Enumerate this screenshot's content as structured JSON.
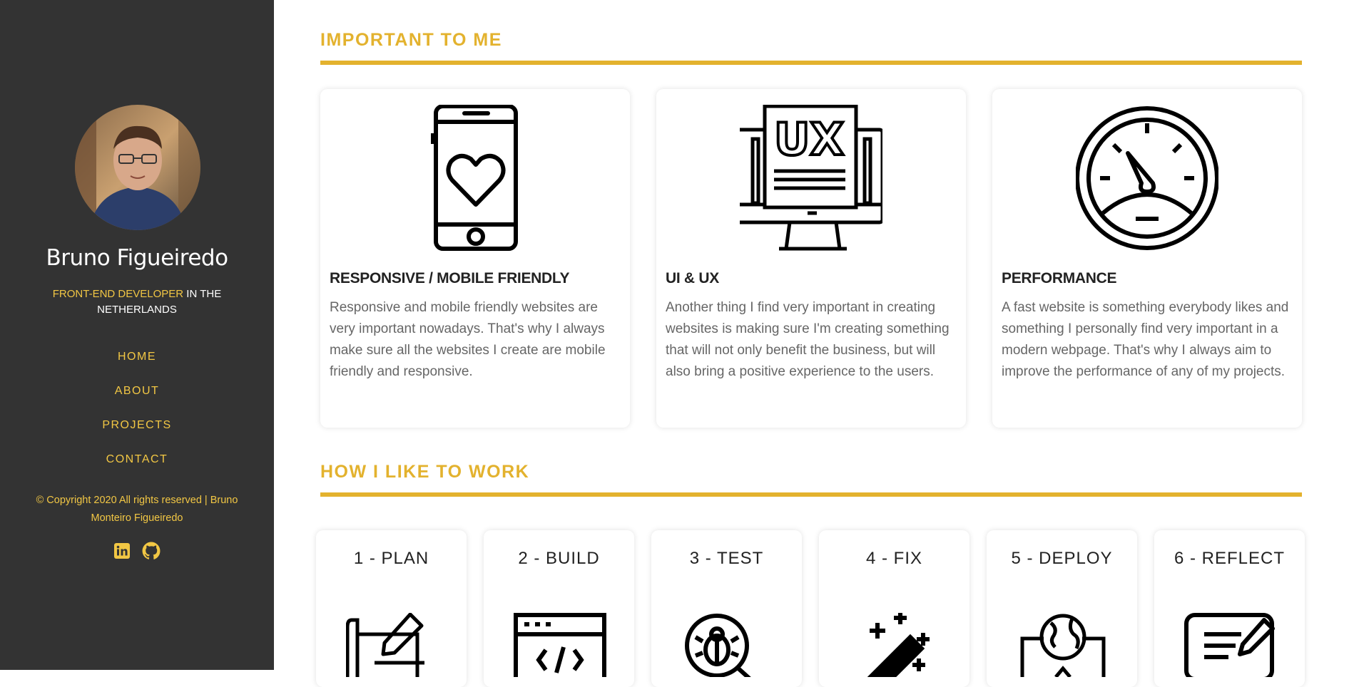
{
  "sidebar": {
    "name": "Bruno Figueiredo",
    "subtitle_highlight": "FRONT-END DEVELOPER",
    "subtitle_rest": " IN THE NETHERLANDS",
    "nav": [
      "HOME",
      "ABOUT",
      "PROJECTS",
      "CONTACT"
    ],
    "copyright": "© Copyright 2020 All rights reserved | Bruno Monteiro Figueiredo",
    "social_icons": [
      "linkedin-icon",
      "github-icon"
    ]
  },
  "important": {
    "title": "IMPORTANT TO ME",
    "cards": [
      {
        "icon": "mobile-heart-icon",
        "title": "RESPONSIVE / MOBILE FRIENDLY",
        "text": "Responsive and mobile friendly websites are very important nowadays. That's why I always make sure all the websites I create are mobile friendly and responsive."
      },
      {
        "icon": "ux-monitor-icon",
        "title": "UI & UX",
        "text": "Another thing I find very important in creating websites is making sure I'm creating something that will not only benefit the business, but will also bring a positive experience to the users."
      },
      {
        "icon": "speedometer-icon",
        "title": "PERFORMANCE",
        "text": "A fast website is something everybody likes and something I personally find very important in a modern webpage. That's why I always aim to improve the performance of any of my projects."
      }
    ]
  },
  "work": {
    "title": "HOW I LIKE TO WORK",
    "steps": [
      {
        "label": "1 - PLAN",
        "icon": "blueprint-pencil-icon"
      },
      {
        "label": "2 - BUILD",
        "icon": "code-window-icon"
      },
      {
        "label": "3 - TEST",
        "icon": "bug-search-icon"
      },
      {
        "label": "4 - FIX",
        "icon": "magic-wand-icon"
      },
      {
        "label": "5 - DEPLOY",
        "icon": "globe-upload-icon"
      },
      {
        "label": "6 - REFLECT",
        "icon": "note-pen-icon"
      }
    ]
  },
  "colors": {
    "sidebar_bg": "#333333",
    "accent": "#e3b22e",
    "nav_accent": "#f2c744"
  }
}
